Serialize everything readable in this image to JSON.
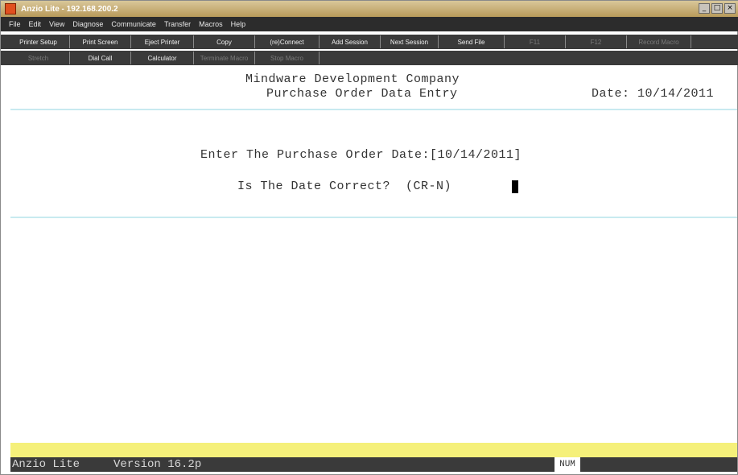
{
  "window": {
    "title": "Anzio Lite - 192.168.200.2"
  },
  "menu": [
    "File",
    "Edit",
    "View",
    "Diagnose",
    "Communicate",
    "Transfer",
    "Macros",
    "Help"
  ],
  "toolbar_row1": [
    {
      "label": "Printer Setup",
      "enabled": true
    },
    {
      "label": "Print Screen",
      "enabled": true
    },
    {
      "label": "Eject Printer",
      "enabled": true
    },
    {
      "label": "Copy",
      "enabled": true
    },
    {
      "label": "(re)Connect",
      "enabled": true
    },
    {
      "label": "Add Session",
      "enabled": true
    },
    {
      "label": "Next Session",
      "enabled": true
    },
    {
      "label": "Send File",
      "enabled": true
    },
    {
      "label": "F11",
      "enabled": false
    },
    {
      "label": "F12",
      "enabled": false
    },
    {
      "label": "Record Macro",
      "enabled": false
    }
  ],
  "toolbar_row2": [
    {
      "label": "Stretch",
      "enabled": false
    },
    {
      "label": "Dial Call",
      "enabled": true
    },
    {
      "label": "Calculator",
      "enabled": true
    },
    {
      "label": "Terminate Macro",
      "enabled": false
    },
    {
      "label": "Stop Macro",
      "enabled": false
    }
  ],
  "screen": {
    "company": "Mindware Development Company",
    "program": "Purchase Order Data Entry",
    "date_label": "Date: 10/14/2011",
    "prompt_date": "Enter The Purchase Order Date:[10/14/2011]",
    "prompt_confirm": "Is The Date Correct?  (CR-N)"
  },
  "status": {
    "left": "Anzio Lite     Version 16.2p",
    "num": "NUM"
  }
}
